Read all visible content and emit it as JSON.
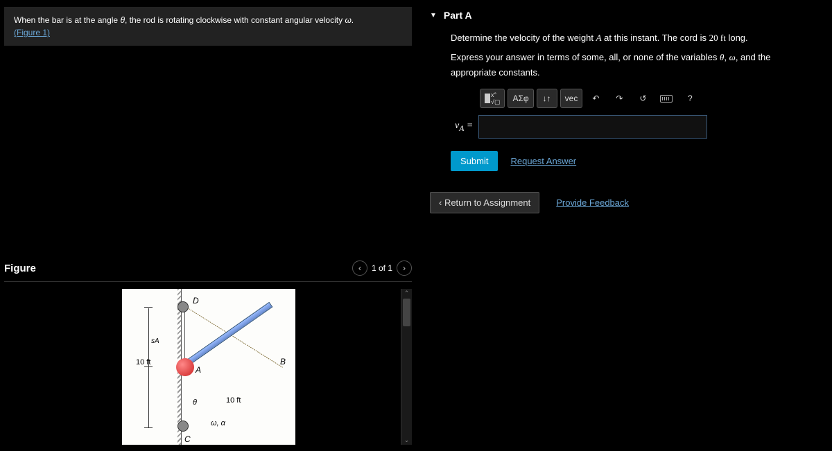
{
  "problem": {
    "line1a": "When the bar is at the angle ",
    "theta": "θ",
    "line1b": ", the rod is rotating clockwise with constant angular velocity ",
    "omega": "ω",
    "line1c": ".",
    "figure_link": "(Figure 1)"
  },
  "figure": {
    "title": "Figure",
    "pager": "1 of 1",
    "labels": {
      "D": "D",
      "B": "B",
      "A": "A",
      "C": "C",
      "sA": "sA",
      "ten_ft_a": "10 ft",
      "ten_ft_b": "10 ft",
      "theta": "θ",
      "omega_alpha": "ω, α"
    }
  },
  "part": {
    "label": "Part A",
    "q1a": "Determine the velocity of the weight ",
    "q1b": " at this instant. The cord is ",
    "q1len": "20 ft",
    "q1c": " long.",
    "q2a": "Express your answer in terms of some, all, or none of the variables ",
    "q2b": ", and the appropriate constants.",
    "var_A": "A",
    "var_theta": "θ",
    "var_omega": "ω",
    "comma": ", "
  },
  "toolbar": {
    "greek": "ΑΣφ",
    "updown": "↓↑",
    "vec": "vec",
    "undo": "↶",
    "redo": "↷",
    "reset": "↺",
    "help": "?"
  },
  "answer": {
    "label_html": "vA =",
    "value": ""
  },
  "actions": {
    "submit": "Submit",
    "request": "Request Answer"
  },
  "bottom": {
    "return": "‹ Return to Assignment",
    "feedback": "Provide Feedback"
  }
}
